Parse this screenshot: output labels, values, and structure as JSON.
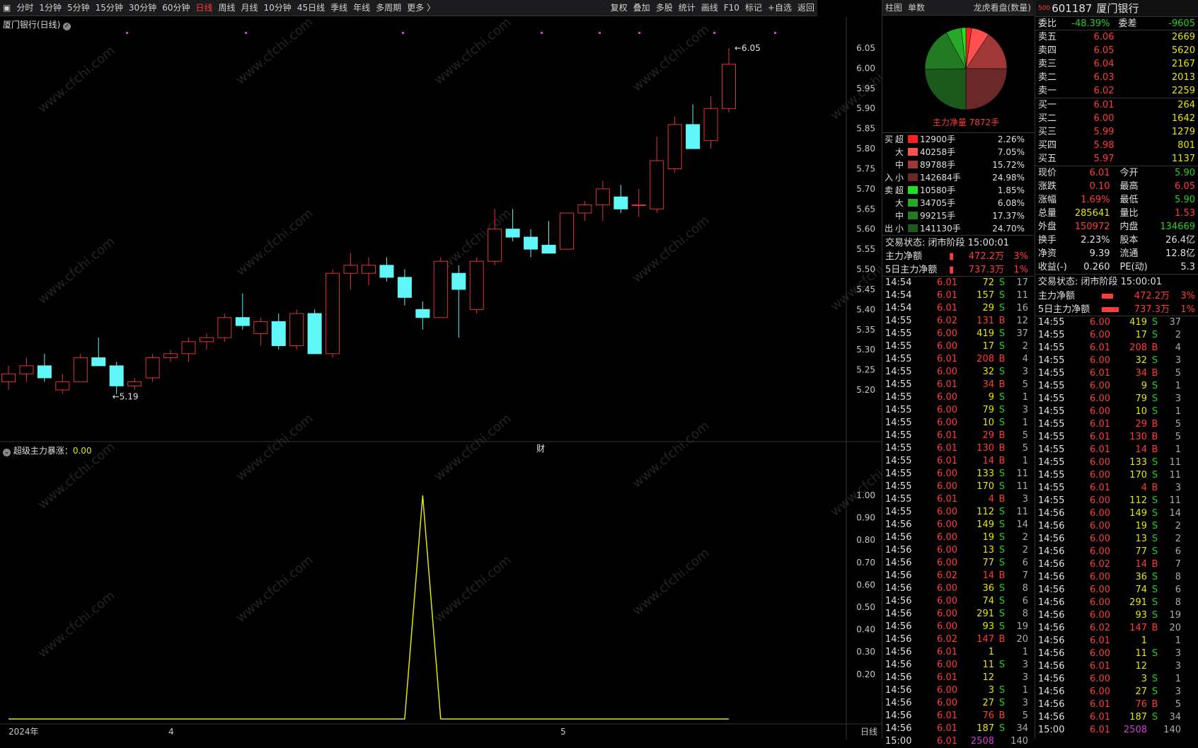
{
  "toolbar": {
    "items": [
      "分时",
      "1分钟",
      "5分钟",
      "15分钟",
      "30分钟",
      "60分钟",
      "日线",
      "周线",
      "月线",
      "10分钟",
      "45日线",
      "季线",
      "年线",
      "多周期",
      "更多 〉"
    ],
    "active_index": 6,
    "right_items": [
      "复权",
      "叠加",
      "多股",
      "统计",
      "画线",
      "F10",
      "标记",
      "+自选",
      "返回"
    ]
  },
  "chart": {
    "title": "厦门银行(日线)",
    "indicator_name": "超级主力暴涨",
    "indicator_value": "0.00",
    "price_ticks": [
      "6.05",
      "6.00",
      "5.95",
      "5.90",
      "5.85",
      "5.80",
      "5.75",
      "5.70",
      "5.65",
      "5.60",
      "5.55",
      "5.50",
      "5.45",
      "5.40",
      "5.35",
      "5.30",
      "5.25",
      "5.20"
    ],
    "ind_ticks": [
      "1.00",
      "0.90",
      "0.80",
      "0.70",
      "0.60",
      "0.50",
      "0.40",
      "0.30",
      "0.20"
    ],
    "x_labels": [
      "2024年",
      "4",
      "5"
    ],
    "period_label": "日线",
    "high_label": "6.05",
    "low_label": "5.19",
    "fin_mark": "财"
  },
  "chart_data": {
    "type": "candlestick",
    "candles": [
      {
        "o": 5.22,
        "h": 5.26,
        "l": 5.2,
        "c": 5.24
      },
      {
        "o": 5.24,
        "h": 5.28,
        "l": 5.22,
        "c": 5.26
      },
      {
        "o": 5.26,
        "h": 5.29,
        "l": 5.22,
        "c": 5.23
      },
      {
        "o": 5.2,
        "h": 5.24,
        "l": 5.19,
        "c": 5.22
      },
      {
        "o": 5.22,
        "h": 5.29,
        "l": 5.22,
        "c": 5.28
      },
      {
        "o": 5.28,
        "h": 5.33,
        "l": 5.26,
        "c": 5.26
      },
      {
        "o": 5.26,
        "h": 5.27,
        "l": 5.19,
        "c": 5.21
      },
      {
        "o": 5.21,
        "h": 5.23,
        "l": 5.2,
        "c": 5.22
      },
      {
        "o": 5.23,
        "h": 5.29,
        "l": 5.22,
        "c": 5.28
      },
      {
        "o": 5.28,
        "h": 5.3,
        "l": 5.27,
        "c": 5.29
      },
      {
        "o": 5.29,
        "h": 5.33,
        "l": 5.27,
        "c": 5.32
      },
      {
        "o": 5.32,
        "h": 5.34,
        "l": 5.3,
        "c": 5.33
      },
      {
        "o": 5.33,
        "h": 5.39,
        "l": 5.32,
        "c": 5.38
      },
      {
        "o": 5.38,
        "h": 5.44,
        "l": 5.35,
        "c": 5.36
      },
      {
        "o": 5.34,
        "h": 5.38,
        "l": 5.31,
        "c": 5.37
      },
      {
        "o": 5.37,
        "h": 5.39,
        "l": 5.3,
        "c": 5.31
      },
      {
        "o": 5.31,
        "h": 5.4,
        "l": 5.3,
        "c": 5.39
      },
      {
        "o": 5.39,
        "h": 5.4,
        "l": 5.29,
        "c": 5.29
      },
      {
        "o": 5.29,
        "h": 5.5,
        "l": 5.28,
        "c": 5.49
      },
      {
        "o": 5.49,
        "h": 5.54,
        "l": 5.45,
        "c": 5.51
      },
      {
        "o": 5.49,
        "h": 5.53,
        "l": 5.46,
        "c": 5.51
      },
      {
        "o": 5.51,
        "h": 5.53,
        "l": 5.47,
        "c": 5.48
      },
      {
        "o": 5.48,
        "h": 5.5,
        "l": 5.41,
        "c": 5.43
      },
      {
        "o": 5.4,
        "h": 5.42,
        "l": 5.35,
        "c": 5.38
      },
      {
        "o": 5.38,
        "h": 5.53,
        "l": 5.38,
        "c": 5.52
      },
      {
        "o": 5.49,
        "h": 5.51,
        "l": 5.33,
        "c": 5.45
      },
      {
        "o": 5.4,
        "h": 5.53,
        "l": 5.39,
        "c": 5.52
      },
      {
        "o": 5.52,
        "h": 5.65,
        "l": 5.51,
        "c": 5.6
      },
      {
        "o": 5.6,
        "h": 5.65,
        "l": 5.57,
        "c": 5.58
      },
      {
        "o": 5.58,
        "h": 5.6,
        "l": 5.53,
        "c": 5.55
      },
      {
        "o": 5.56,
        "h": 5.62,
        "l": 5.54,
        "c": 5.54
      },
      {
        "o": 5.55,
        "h": 5.64,
        "l": 5.55,
        "c": 5.64
      },
      {
        "o": 5.64,
        "h": 5.67,
        "l": 5.62,
        "c": 5.66
      },
      {
        "o": 5.66,
        "h": 5.72,
        "l": 5.62,
        "c": 5.7
      },
      {
        "o": 5.68,
        "h": 5.71,
        "l": 5.64,
        "c": 5.65
      },
      {
        "o": 5.66,
        "h": 5.7,
        "l": 5.63,
        "c": 5.66
      },
      {
        "o": 5.65,
        "h": 5.83,
        "l": 5.64,
        "c": 5.77
      },
      {
        "o": 5.75,
        "h": 5.88,
        "l": 5.74,
        "c": 5.86
      },
      {
        "o": 5.86,
        "h": 5.91,
        "l": 5.8,
        "c": 5.8
      },
      {
        "o": 5.82,
        "h": 5.93,
        "l": 5.8,
        "c": 5.9
      },
      {
        "o": 5.9,
        "h": 6.05,
        "l": 5.89,
        "c": 6.01
      }
    ],
    "indicator": [
      0,
      0,
      0,
      0,
      0,
      0,
      0,
      0,
      0,
      0,
      0,
      0,
      0,
      0,
      0,
      0,
      0,
      0,
      0,
      0,
      0,
      0,
      0,
      1,
      0,
      0,
      0,
      0,
      0,
      0,
      0,
      0,
      0,
      0,
      0,
      0,
      0,
      0,
      0,
      0,
      0
    ]
  },
  "colors": {
    "up": "#e0343a",
    "down": "#5ff7f7",
    "bg": "#000000",
    "ind_line": "#e6e600"
  },
  "panelA": {
    "header_left": [
      "柱图",
      "单数"
    ],
    "header_right": "龙虎看盘(数量)",
    "net_main": "主力净量 7872手",
    "flows": [
      {
        "side": "买",
        "lvl": "超",
        "vol": "12900手",
        "pct": "2.26%",
        "color": "#ff2020",
        "bar": 1.0
      },
      {
        "side": "",
        "lvl": "大",
        "vol": "40258手",
        "pct": "7.05%",
        "color": "#ff5050",
        "bar": 1.0
      },
      {
        "side": "",
        "lvl": "中",
        "vol": "89788手",
        "pct": "15.72%",
        "color": "#a03838",
        "bar": 1.0
      },
      {
        "side": "入",
        "lvl": "小",
        "vol": "142684手",
        "pct": "24.98%",
        "color": "#6a2828",
        "bar": 1.0
      },
      {
        "side": "卖",
        "lvl": "超",
        "vol": "10580手",
        "pct": "1.85%",
        "color": "#20e020",
        "bar": 1.0
      },
      {
        "side": "",
        "lvl": "大",
        "vol": "34705手",
        "pct": "6.08%",
        "color": "#28a828",
        "bar": 1.0
      },
      {
        "side": "",
        "lvl": "中",
        "vol": "99215手",
        "pct": "17.37%",
        "color": "#227a22",
        "bar": 1.0
      },
      {
        "side": "出",
        "lvl": "小",
        "vol": "141130手",
        "pct": "24.70%",
        "color": "#1c5a1c",
        "bar": 1.0
      }
    ],
    "status": "交易状态: 闭市阶段 15:00:01",
    "net1": {
      "label": "主力净额",
      "val": "472.2万",
      "pct": "3%"
    },
    "net5": {
      "label": "5日主力净额",
      "val": "737.3万",
      "pct": "1%"
    },
    "pie": [
      {
        "v": 2.26,
        "c": "#ff2020"
      },
      {
        "v": 7.05,
        "c": "#ff5050"
      },
      {
        "v": 15.72,
        "c": "#a03838"
      },
      {
        "v": 24.98,
        "c": "#6a2828"
      },
      {
        "v": 24.7,
        "c": "#1c5a1c"
      },
      {
        "v": 17.37,
        "c": "#227a22"
      },
      {
        "v": 6.08,
        "c": "#28a828"
      },
      {
        "v": 1.85,
        "c": "#20e020"
      }
    ],
    "ticks": [
      [
        "14:54",
        "6.01",
        "72",
        "S",
        "17"
      ],
      [
        "14:54",
        "6.01",
        "157",
        "S",
        "11"
      ],
      [
        "14:54",
        "6.01",
        "29",
        "S",
        "16"
      ],
      [
        "14:55",
        "6.02",
        "131",
        "B",
        "12"
      ],
      [
        "14:55",
        "6.00",
        "419",
        "S",
        "37"
      ],
      [
        "14:55",
        "6.00",
        "17",
        "S",
        "2"
      ],
      [
        "14:55",
        "6.01",
        "208",
        "B",
        "4"
      ],
      [
        "14:55",
        "6.00",
        "32",
        "S",
        "3"
      ],
      [
        "14:55",
        "6.01",
        "34",
        "B",
        "5"
      ],
      [
        "14:55",
        "6.00",
        "9",
        "S",
        "1"
      ],
      [
        "14:55",
        "6.00",
        "79",
        "S",
        "3"
      ],
      [
        "14:55",
        "6.00",
        "10",
        "S",
        "1"
      ],
      [
        "14:55",
        "6.01",
        "29",
        "B",
        "5"
      ],
      [
        "14:55",
        "6.01",
        "130",
        "B",
        "5"
      ],
      [
        "14:55",
        "6.01",
        "14",
        "B",
        "1"
      ],
      [
        "14:55",
        "6.00",
        "133",
        "S",
        "11"
      ],
      [
        "14:55",
        "6.00",
        "170",
        "S",
        "11"
      ],
      [
        "14:55",
        "6.01",
        "4",
        "B",
        "3"
      ],
      [
        "14:55",
        "6.00",
        "112",
        "S",
        "11"
      ],
      [
        "14:56",
        "6.00",
        "149",
        "S",
        "14"
      ],
      [
        "14:56",
        "6.00",
        "19",
        "S",
        "2"
      ],
      [
        "14:56",
        "6.00",
        "13",
        "S",
        "2"
      ],
      [
        "14:56",
        "6.00",
        "77",
        "S",
        "6"
      ],
      [
        "14:56",
        "6.02",
        "14",
        "B",
        "7"
      ],
      [
        "14:56",
        "6.00",
        "36",
        "S",
        "8"
      ],
      [
        "14:56",
        "6.00",
        "74",
        "S",
        "6"
      ],
      [
        "14:56",
        "6.00",
        "291",
        "S",
        "8"
      ],
      [
        "14:56",
        "6.00",
        "93",
        "S",
        "19"
      ],
      [
        "14:56",
        "6.02",
        "147",
        "B",
        "20"
      ],
      [
        "14:56",
        "6.01",
        "1",
        "",
        "1"
      ],
      [
        "14:56",
        "6.00",
        "11",
        "S",
        "3"
      ],
      [
        "14:56",
        "6.01",
        "12",
        "",
        "3"
      ],
      [
        "14:56",
        "6.00",
        "3",
        "S",
        "1"
      ],
      [
        "14:56",
        "6.00",
        "27",
        "S",
        "3"
      ],
      [
        "14:56",
        "6.01",
        "76",
        "B",
        "5"
      ],
      [
        "14:56",
        "6.01",
        "187",
        "S",
        "34"
      ],
      [
        "15:00",
        "6.01",
        "2508",
        "",
        "140"
      ]
    ]
  },
  "panelB": {
    "code": "601187",
    "name": "厦门银行",
    "badge": "500",
    "weibi": {
      "l1": "委比",
      "v1": "-48.39%",
      "l2": "委差",
      "v2": "-9605"
    },
    "asks": [
      [
        "卖五",
        "6.06",
        "2669"
      ],
      [
        "卖四",
        "6.05",
        "5620"
      ],
      [
        "卖三",
        "6.04",
        "2167"
      ],
      [
        "卖二",
        "6.03",
        "2013"
      ],
      [
        "卖一",
        "6.02",
        "2259"
      ]
    ],
    "bids": [
      [
        "买一",
        "6.01",
        "264"
      ],
      [
        "买二",
        "6.00",
        "1642"
      ],
      [
        "买三",
        "5.99",
        "1279"
      ],
      [
        "买四",
        "5.98",
        "801"
      ],
      [
        "买五",
        "5.97",
        "1137"
      ]
    ],
    "quote": [
      [
        "现价",
        "6.01",
        "今开",
        "5.90"
      ],
      [
        "涨跌",
        "0.10",
        "最高",
        "6.05"
      ],
      [
        "涨幅",
        "1.69%",
        "最低",
        "5.90"
      ],
      [
        "总量",
        "285641",
        "量比",
        "1.53"
      ],
      [
        "外盘",
        "150972",
        "内盘",
        "134669"
      ],
      [
        "换手",
        "2.23%",
        "股本",
        "26.4亿"
      ],
      [
        "净资",
        "9.39",
        "流通",
        "12.8亿"
      ],
      [
        "收益(-)",
        "0.260",
        "PE(动)",
        "5.3"
      ]
    ],
    "status": "交易状态: 闭市阶段 15:00:01",
    "net1": {
      "label": "主力净额",
      "val": "472.2万",
      "pct": "3%"
    },
    "net5": {
      "label": "5日主力净额",
      "val": "737.3万",
      "pct": "1%"
    }
  },
  "watermark": "www.cfchi.com"
}
